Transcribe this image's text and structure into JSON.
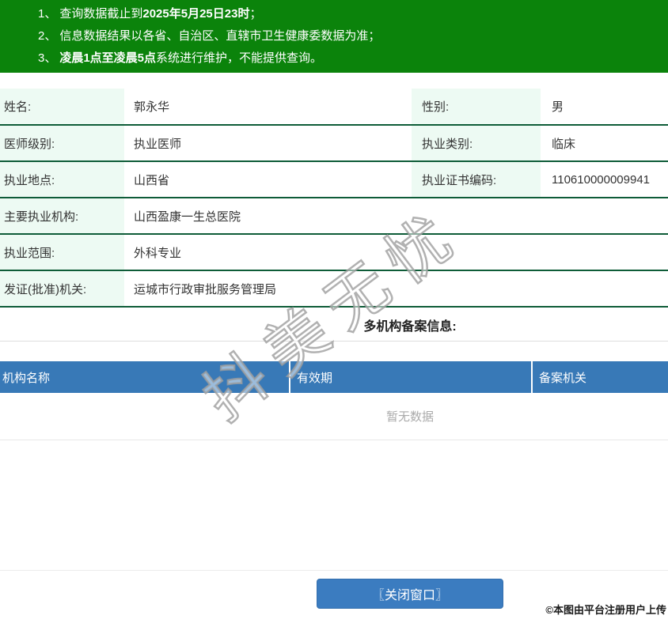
{
  "notice": {
    "items": [
      {
        "num": "1、",
        "pre": "查询数据截止到",
        "bold": "2025年5月25日23时",
        "post": "；"
      },
      {
        "num": "2、",
        "pre": "信息数据结果以各省、自治区、直辖市卫生健康委数据为准；",
        "bold": "",
        "post": ""
      },
      {
        "num": "3、",
        "pre": "",
        "bold": "凌晨1点至凌晨5点",
        "post": "系统进行维护，不能提供查询。"
      }
    ]
  },
  "profile": {
    "rows": [
      {
        "label": "姓名:",
        "value": "郭永华",
        "label2": "性别:",
        "value2": "男"
      },
      {
        "label": "医师级别:",
        "value": "执业医师",
        "label2": "执业类别:",
        "value2": "临床"
      },
      {
        "label": "执业地点:",
        "value": "山西省",
        "label2": "执业证书编码:",
        "value2": "110610000009941"
      },
      {
        "label": "主要执业机构:",
        "value": "山西盈康一生总医院"
      },
      {
        "label": "执业范围:",
        "value": "外科专业"
      },
      {
        "label": "发证(批准)机关:",
        "value": "运城市行政审批服务管理局"
      }
    ]
  },
  "filing": {
    "title": "多机构备案信息:",
    "columns": [
      "机构名称",
      "有效期",
      "备案机关"
    ],
    "empty_text": "暂无数据"
  },
  "footer": {
    "close_button": "〖关闭窗口〗"
  },
  "watermark": "抖美无忧",
  "copyright": "©本图由平台注册用户上传",
  "colors": {
    "banner_green": "#0b830b",
    "row_divider_green": "#0e5c38",
    "label_cell_mint": "#edfaf3",
    "table_header_blue": "#3879b7",
    "button_blue": "#3b7cc0",
    "empty_text_gray": "#aaaaaa"
  }
}
